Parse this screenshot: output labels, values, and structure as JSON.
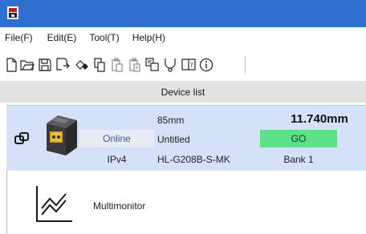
{
  "menu": [
    "File(F)",
    "Edit(E)",
    "Tool(T)",
    "Help(H)"
  ],
  "toolbar": {
    "icons": [
      "new-file-icon",
      "open-folder-icon",
      "save-icon",
      "save-as-icon",
      "connect-icon",
      "copy-icon",
      "paste-icon",
      "paste-all-icon",
      "settings-transfer-icon",
      "diagnose-icon",
      "manual-icon",
      "info-icon"
    ]
  },
  "device_list": {
    "header": "Device list"
  },
  "device": {
    "status": "Online",
    "protocol": "IPv4",
    "range": "85mm",
    "name": "Untitled",
    "model": "HL-G208B-S-MK",
    "measurement": "11.740mm",
    "judgement": "GO",
    "bank": "Bank 1"
  },
  "multimonitor": {
    "label": "Multimonitor"
  },
  "colors": {
    "titlebar": "#2f6fd0",
    "device_row": "#d5e1f8",
    "go": "#5ce08a",
    "header": "#e2e2e2"
  }
}
